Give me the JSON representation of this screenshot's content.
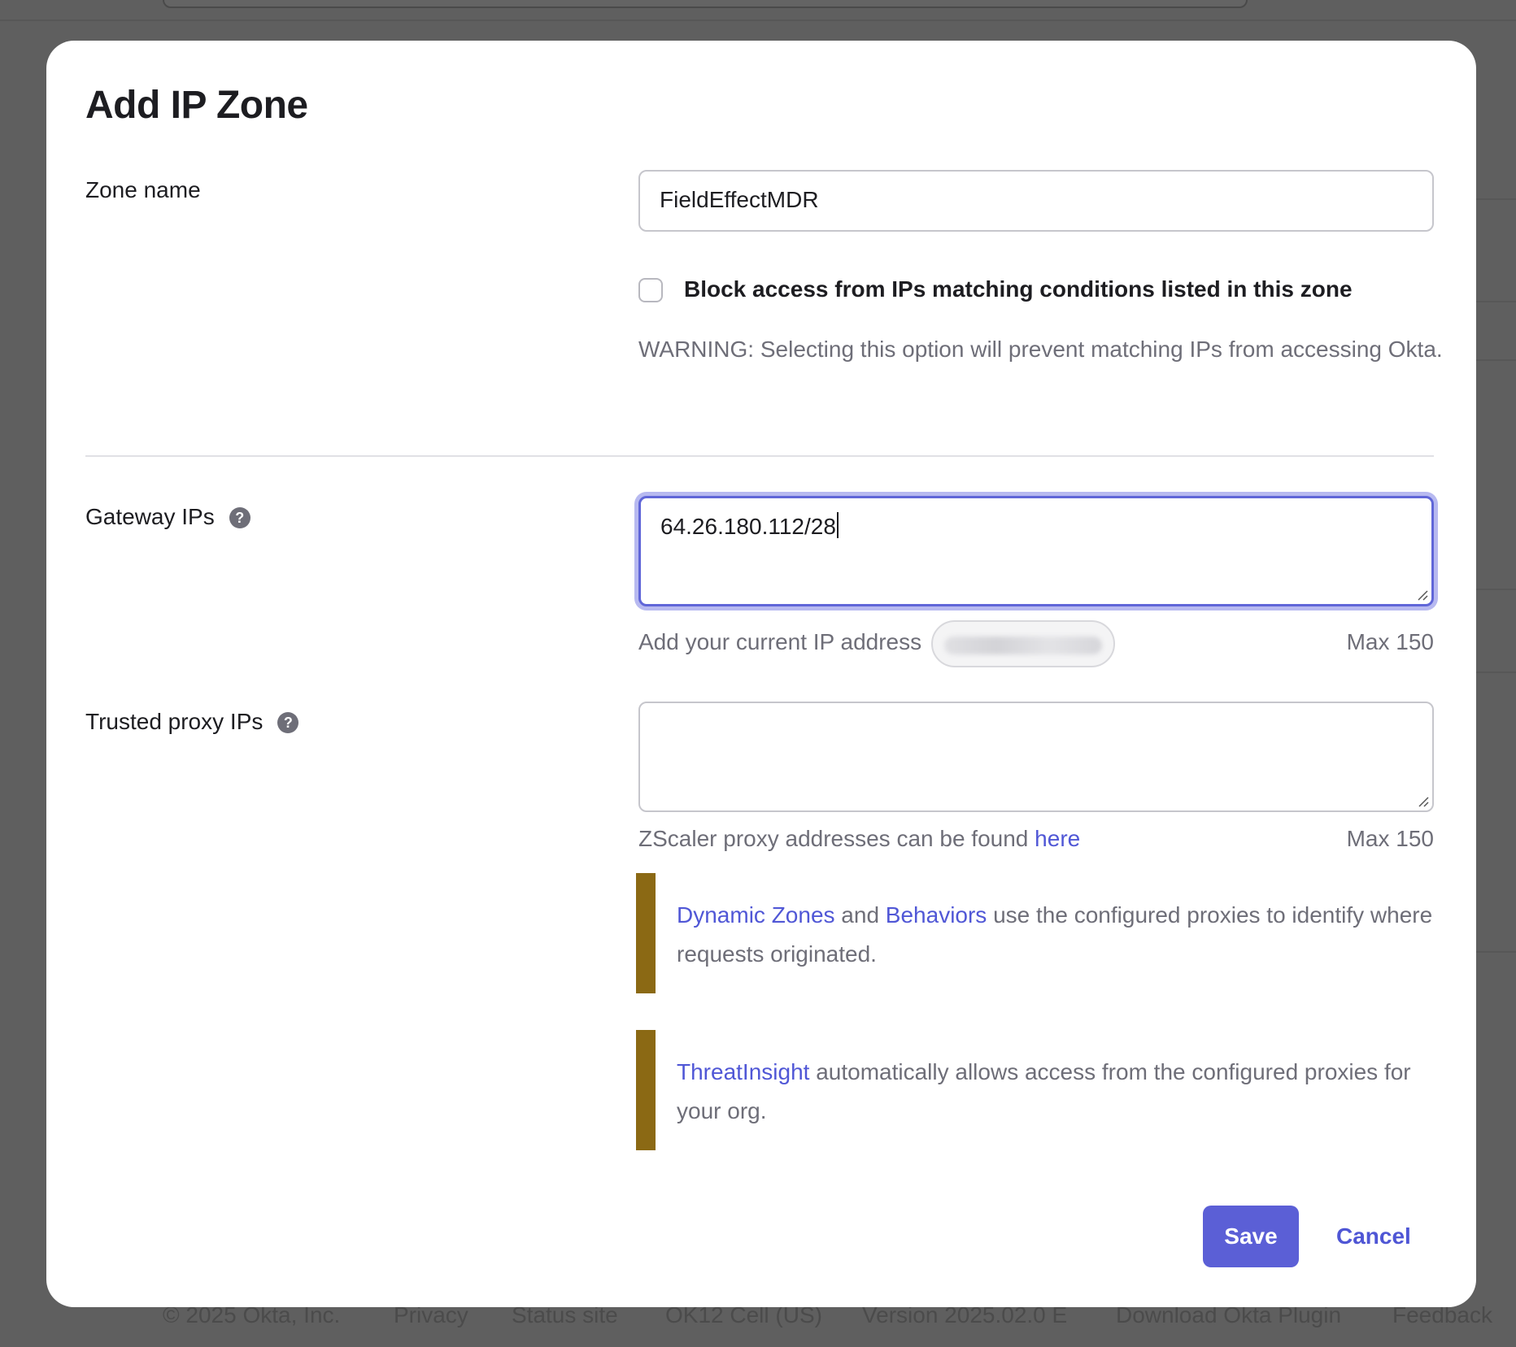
{
  "footer": {
    "copyright": "© 2025 Okta, Inc.",
    "privacy": "Privacy",
    "status_site": "Status site",
    "cell": "OK12 Cell (US)",
    "version": "Version 2025.02.0 E",
    "download_plugin": "Download Okta Plugin",
    "feedback": "Feedback"
  },
  "dialog": {
    "title": "Add IP Zone",
    "zone_name": {
      "label": "Zone name",
      "value": "FieldEffectMDR"
    },
    "block_access": {
      "checked": false,
      "label": "Block access from IPs matching conditions listed in this zone",
      "warning": "WARNING: Selecting this option will prevent matching IPs from accessing Okta."
    },
    "gateway_ips": {
      "label": "Gateway IPs",
      "value": "64.26.180.112/28",
      "add_current_ip_label": "Add your current IP address",
      "max_label": "Max 150"
    },
    "trusted_proxy_ips": {
      "label": "Trusted proxy IPs",
      "value": "",
      "hint_prefix": "ZScaler proxy addresses can be found",
      "hint_link": "here",
      "max_label": "Max 150"
    },
    "callout_dynamic": {
      "link1": "Dynamic Zones",
      "and": "and",
      "link2": "Behaviors",
      "text": "use the configured proxies to identify where requests originated."
    },
    "callout_threat": {
      "link": "ThreatInsight",
      "text": "automatically allows access from the configured proxies for your org."
    },
    "save_label": "Save",
    "cancel_label": "Cancel"
  },
  "colors": {
    "primary": "#5b5fd6",
    "link": "#5057d6",
    "callout_bar": "#8b6914",
    "focus_ring": "#b7b9f0"
  }
}
